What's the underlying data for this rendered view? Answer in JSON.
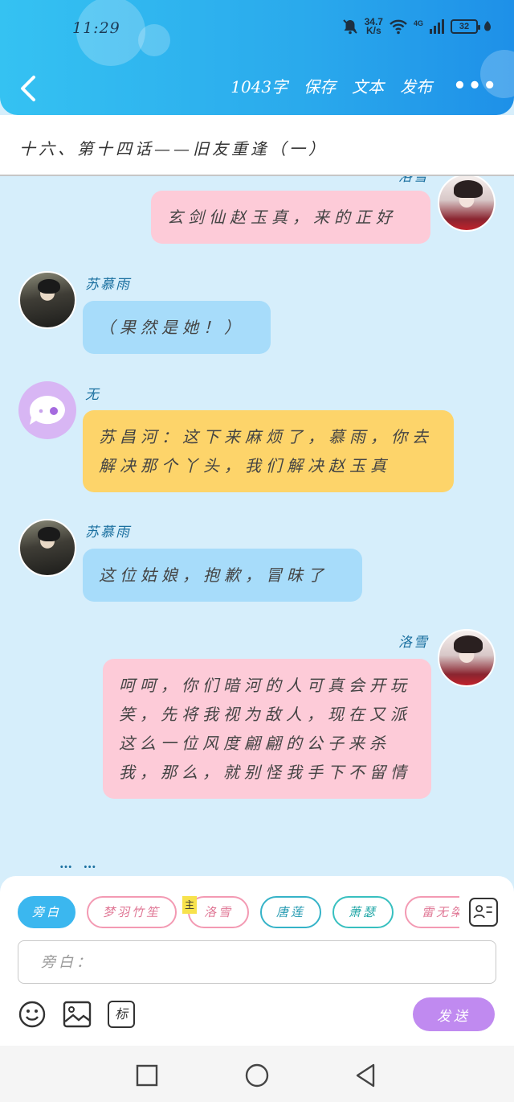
{
  "status_bar": {
    "time": "11:29",
    "net_speed_value": "34.7",
    "net_speed_unit": "K/s",
    "network": "4G",
    "battery": "32"
  },
  "toolbar": {
    "word_count": "1043字",
    "save_label": "保存",
    "text_label": "文本",
    "publish_label": "发布",
    "more_label": "•••"
  },
  "chapter": {
    "title": "十六、第十四话——旧友重逢（一）"
  },
  "messages": [
    {
      "side": "right",
      "speaker": "洛雪",
      "avatar": "female-avatar",
      "text": "玄剑仙赵玉真，来的正好",
      "color": "pink"
    },
    {
      "side": "left",
      "speaker": "苏慕雨",
      "avatar": "male-avatar",
      "text": "（果然是她！）",
      "color": "blue"
    },
    {
      "side": "left",
      "speaker": "无",
      "avatar": "narrator-avatar",
      "text": "苏昌河：这下来麻烦了，慕雨，你去解决那个丫头，我们解决赵玉真",
      "color": "yellow"
    },
    {
      "side": "left",
      "speaker": "苏慕雨",
      "avatar": "male-avatar",
      "text": "这位姑娘，抱歉，冒昧了",
      "color": "blue"
    },
    {
      "side": "right",
      "speaker": "洛雪",
      "avatar": "female-avatar",
      "text": "呵呵，你们暗河的人可真会开玩笑，先将我视为敌人，现在又派这么一位风度翩翩的公子来杀我，那么，就别怪我手下不留情",
      "color": "pink"
    }
  ],
  "more_dots": "… …",
  "composer": {
    "roles": [
      "旁白",
      "梦羽竹笙",
      "洛雪",
      "唐莲",
      "萧瑟",
      "雷无桀"
    ],
    "active_role": "旁白",
    "main_tag": "主",
    "input_placeholder": "旁白：",
    "mark_label": "标",
    "send_label": "发送"
  },
  "colors": {
    "header": "#2aa9ec",
    "chat_bg": "#d6eefb",
    "pink": "#fdcbd8",
    "blue": "#a7dcfa",
    "yellow": "#fdd46a",
    "send": "#c08af0"
  }
}
